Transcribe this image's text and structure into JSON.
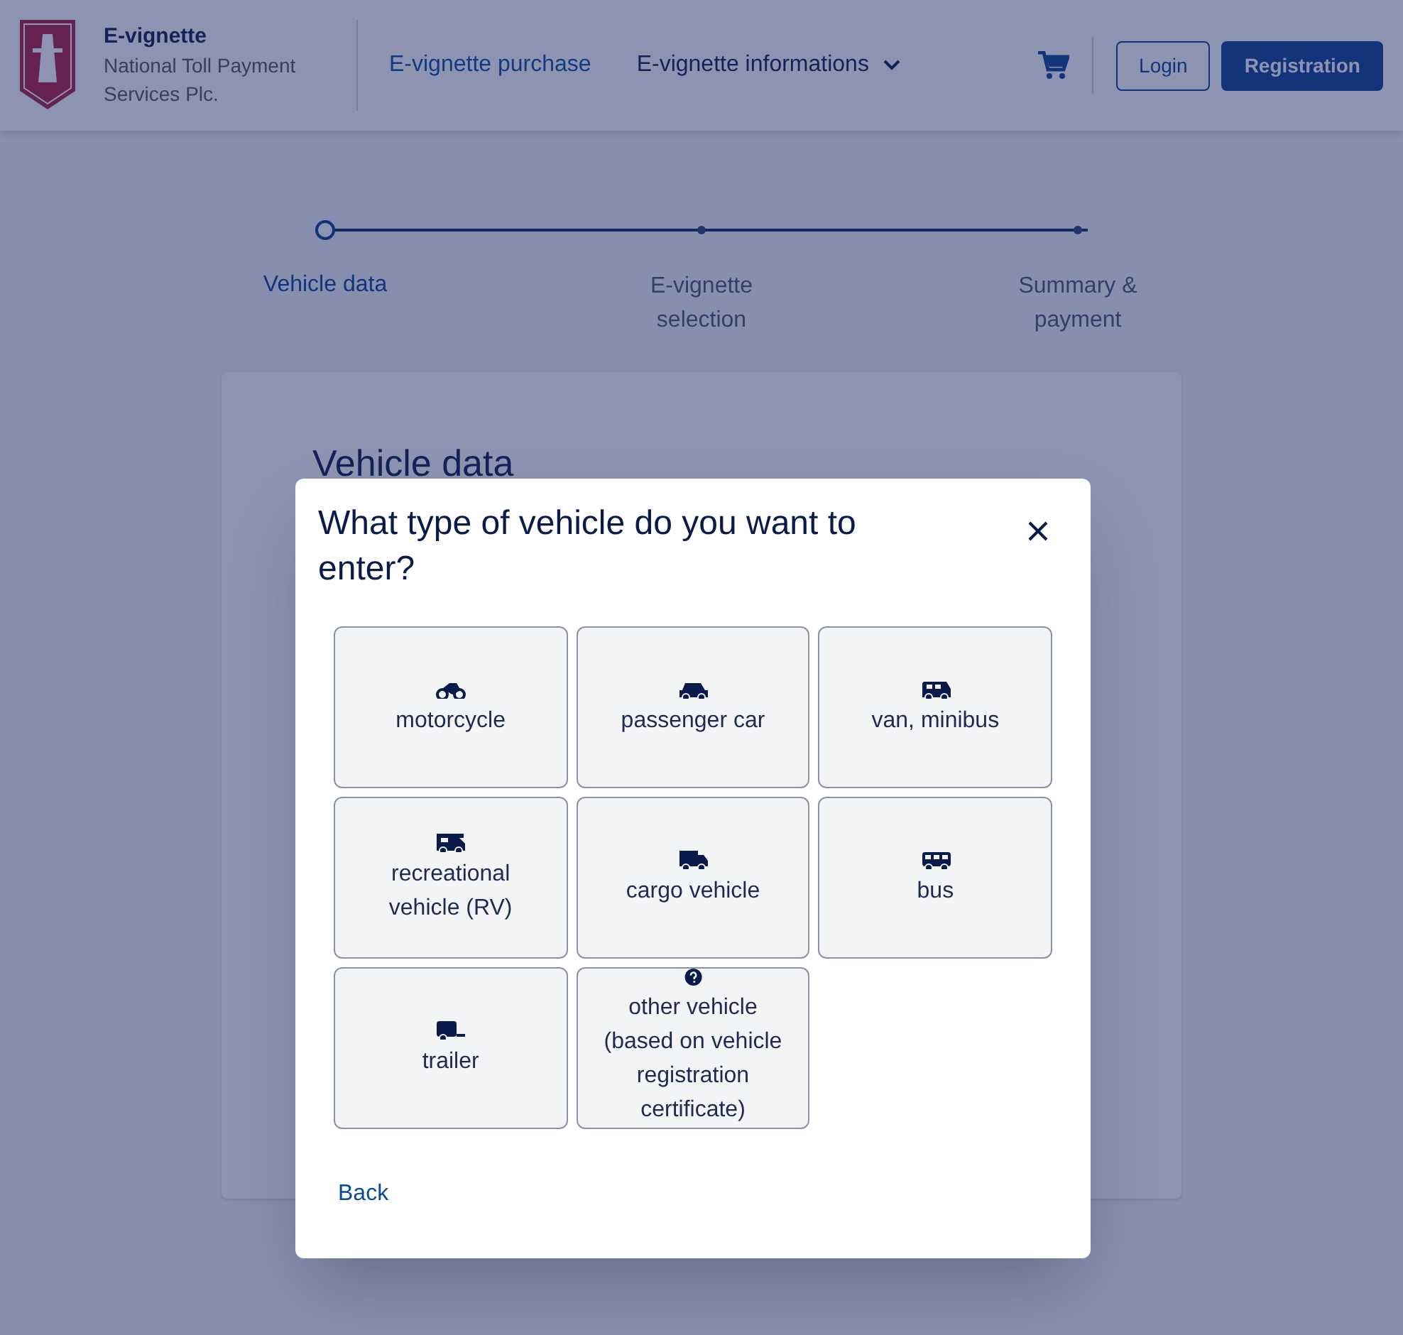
{
  "header": {
    "brand": {
      "title": "E-vignette",
      "subtitle": "National Toll Payment Services Plc."
    },
    "nav": [
      {
        "label": "E-vignette purchase",
        "dropdown": false
      },
      {
        "label": "E-vignette informations",
        "dropdown": true
      }
    ],
    "buttons": [
      {
        "label": "Login",
        "kind": "outline"
      },
      {
        "label": "Registration",
        "kind": "primary"
      }
    ]
  },
  "steps": [
    {
      "label": "Vehicle data",
      "selected": true
    },
    {
      "label": "E-vignette selection",
      "selected": false
    },
    {
      "label": "Summary & payment",
      "selected": false
    }
  ],
  "card": {
    "title": "Vehicle data"
  },
  "dialog": {
    "title": "What type of vehicle do you want to enter?",
    "options": [
      {
        "label": "motorcycle",
        "kind": "motorcycle"
      },
      {
        "label": "passenger car",
        "kind": "car"
      },
      {
        "label": "van, minibus",
        "kind": "van"
      },
      {
        "label": "recreational vehicle (RV)",
        "kind": "rv"
      },
      {
        "label": "cargo vehicle",
        "kind": "truck"
      },
      {
        "label": "bus",
        "kind": "bus"
      },
      {
        "label": "trailer",
        "kind": "trailer"
      },
      {
        "label": "other vehicle (based on vehicle registration certificate)",
        "kind": "other"
      }
    ],
    "back": "Back"
  }
}
